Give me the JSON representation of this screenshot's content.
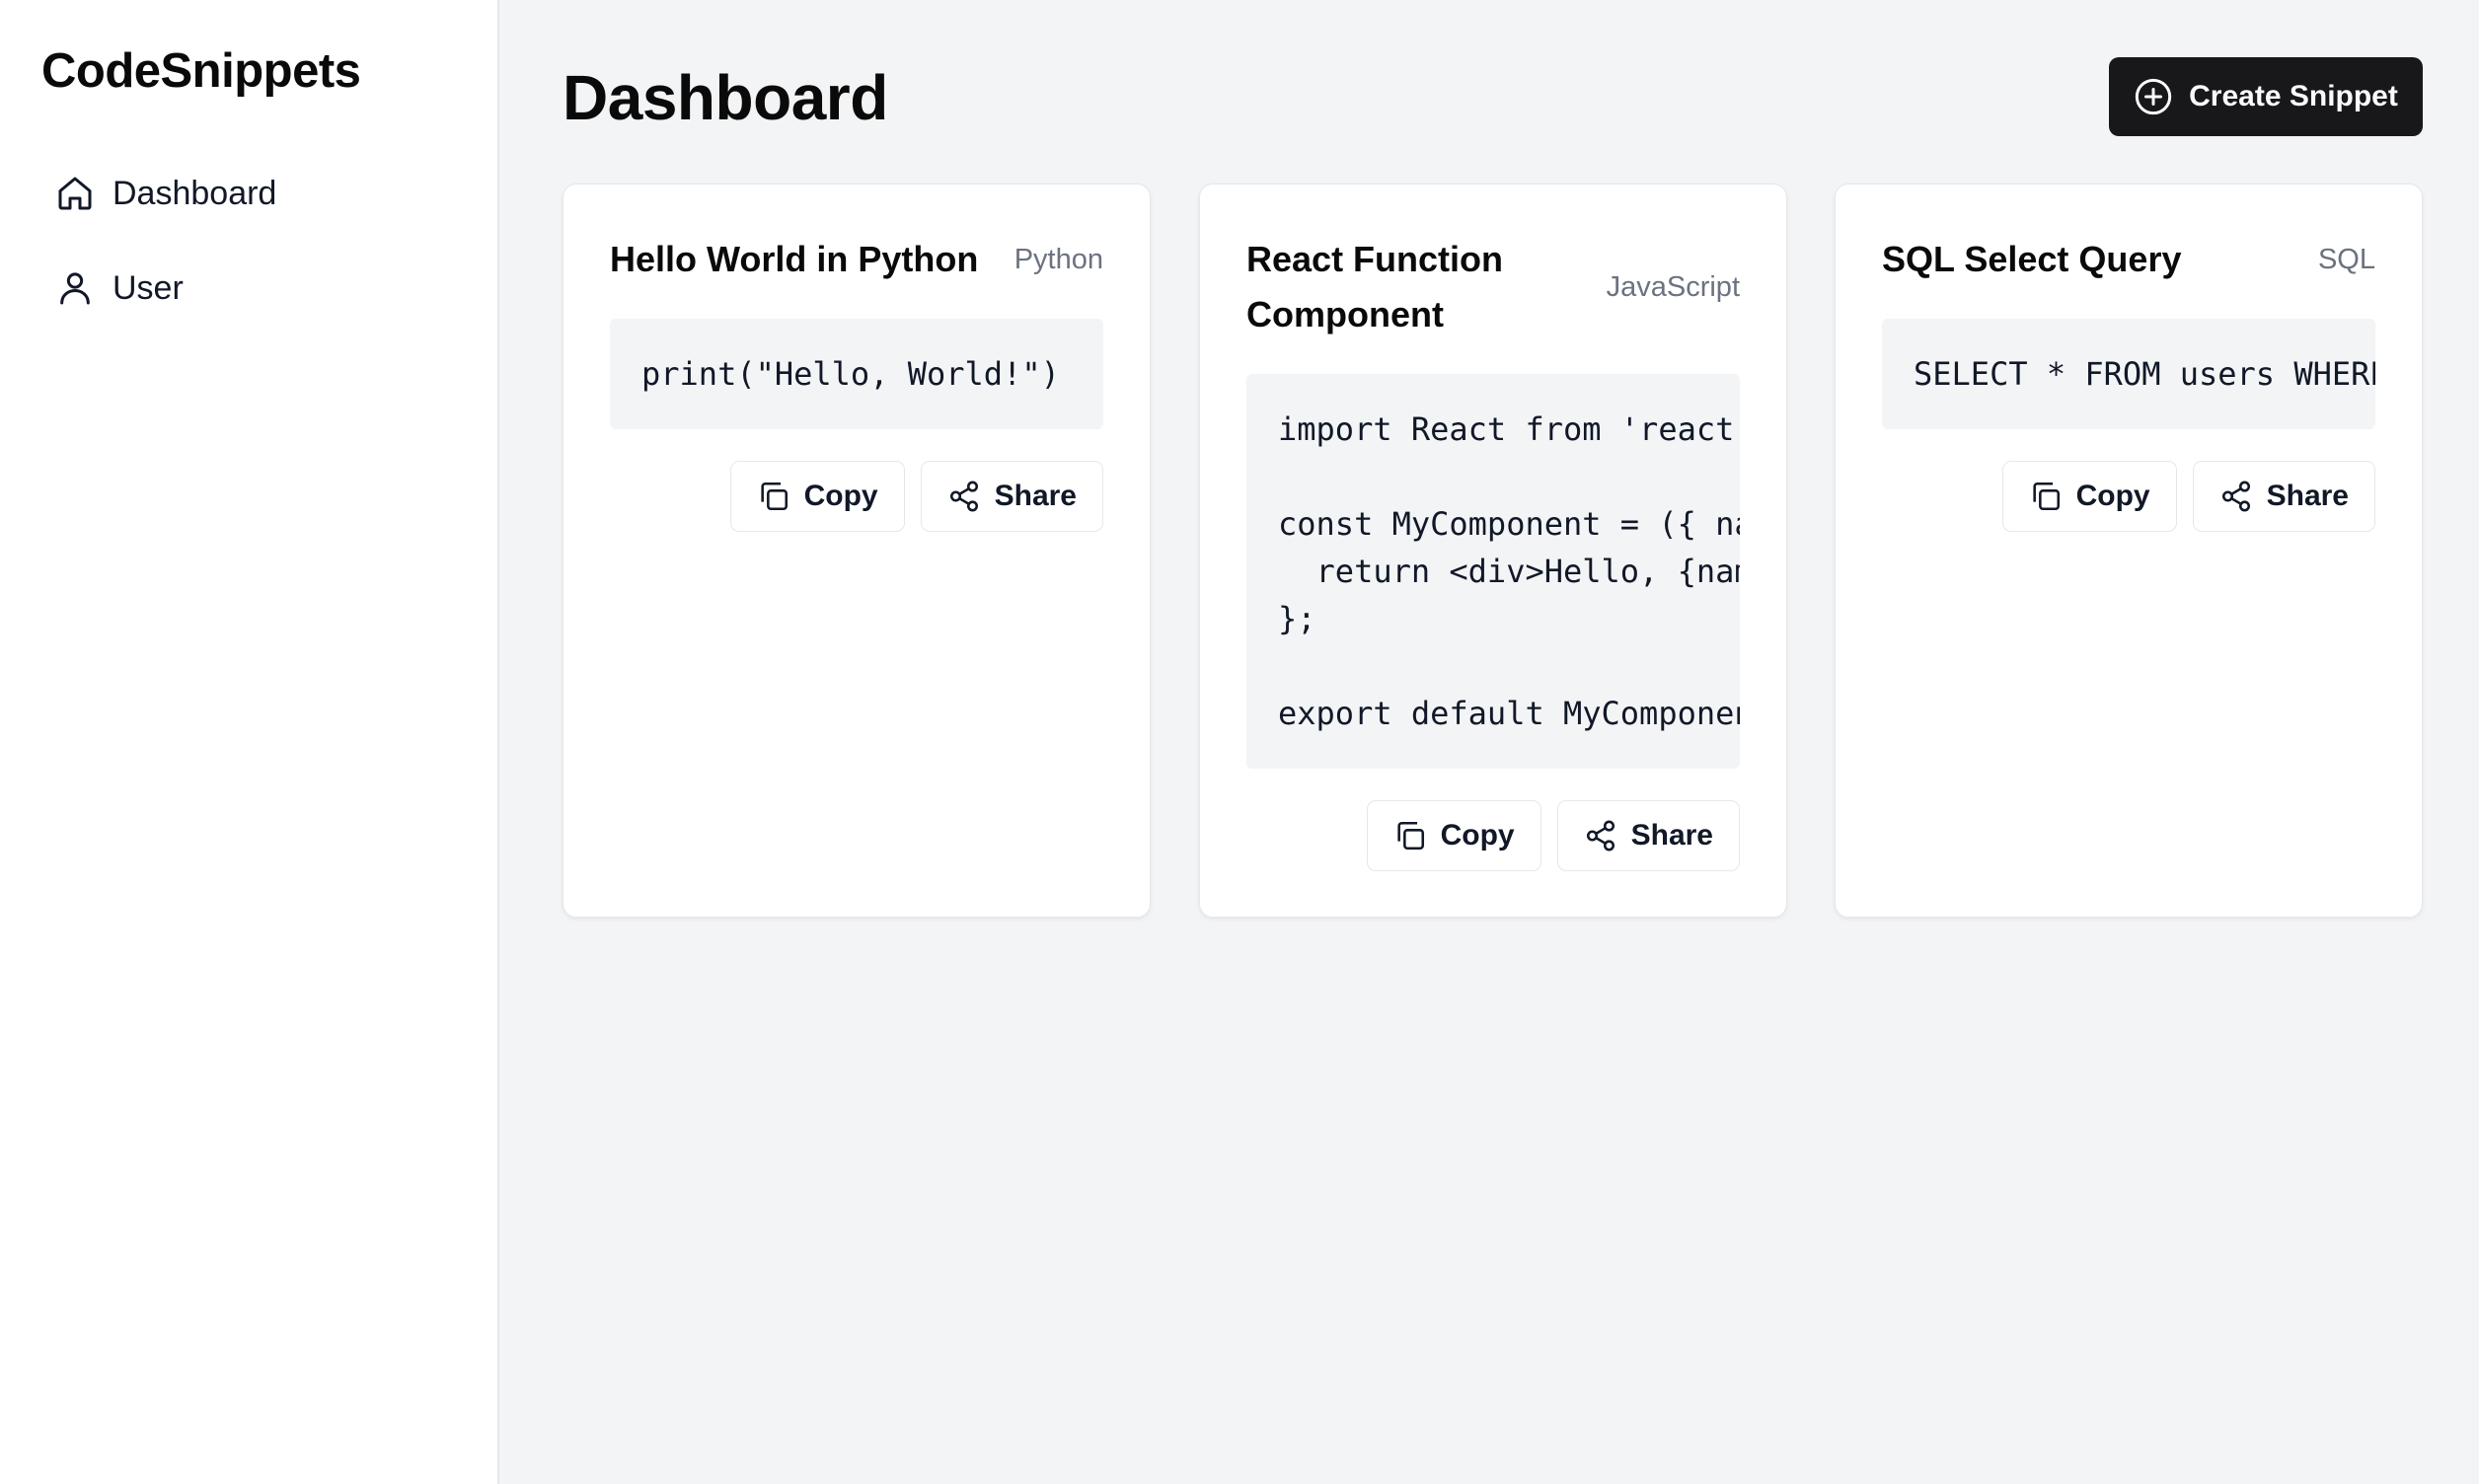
{
  "app": {
    "logo": "CodeSnippets"
  },
  "sidebar": {
    "items": [
      {
        "label": "Dashboard",
        "icon": "home-icon"
      },
      {
        "label": "User",
        "icon": "user-icon"
      }
    ]
  },
  "header": {
    "title": "Dashboard",
    "create_label": "Create Snippet",
    "create_icon": "plus-circle-icon"
  },
  "snippets": [
    {
      "title": "Hello World in Python",
      "language": "Python",
      "code": "print(\"Hello, World!\")",
      "copy_label": "Copy",
      "share_label": "Share"
    },
    {
      "title": "React Function Component",
      "language": "JavaScript",
      "code": "import React from 'react';\n\nconst MyComponent = ({ name }) => {\n  return <div>Hello, {name}</div>;\n};\n\nexport default MyComponent;",
      "copy_label": "Copy",
      "share_label": "Share"
    },
    {
      "title": "SQL Select Query",
      "language": "SQL",
      "code": "SELECT * FROM users WHERE",
      "copy_label": "Copy",
      "share_label": "Share"
    }
  ],
  "colors": {
    "primary_button": "#18181b",
    "background": "#f3f4f6",
    "muted_text": "#6b7280"
  }
}
